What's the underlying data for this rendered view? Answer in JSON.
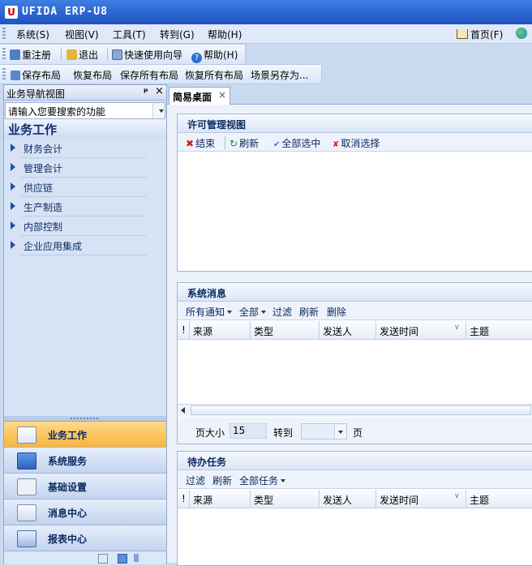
{
  "app": {
    "title": "UFIDA ERP-U8",
    "logo_text": "U"
  },
  "menu": {
    "items": [
      "系统(S)",
      "视图(V)",
      "工具(T)",
      "转到(G)",
      "帮助(H)"
    ],
    "home": "首页(F)"
  },
  "toolbar1": [
    "重注册",
    "退出",
    "快速使用向导",
    "帮助(H)"
  ],
  "toolbar2": [
    "保存布局",
    "恢复布局",
    "保存所有布局",
    "恢复所有布局",
    "场景另存为..."
  ],
  "nav": {
    "header": "业务导航视图",
    "pin": "ᵖ",
    "close": "×",
    "search_placeholder": "请输入您要搜索的功能",
    "section_title": "业务工作",
    "items": [
      "财务会计",
      "管理会计",
      "供应链",
      "生产制造",
      "内部控制",
      "企业应用集成"
    ],
    "buttons": [
      "业务工作",
      "系统服务",
      "基础设置",
      "消息中心",
      "报表中心"
    ]
  },
  "tab": {
    "label": "简易桌面",
    "close": "×"
  },
  "license_panel": {
    "title": "许可管理视图",
    "tools": [
      "结束",
      "刷新",
      "全部选中",
      "取消选择"
    ]
  },
  "messages_panel": {
    "title": "系统消息",
    "tools": [
      "所有通知",
      "全部",
      "过滤",
      "刷新",
      "删除"
    ],
    "columns": [
      "!",
      "来源",
      "类型",
      "发送人",
      "发送时间",
      "主题"
    ],
    "page_size_label": "页大小",
    "page_size_value": "15",
    "goto_label": "转到",
    "page_label": "页"
  },
  "tasks_panel": {
    "title": "待办任务",
    "tools": [
      "过滤",
      "刷新",
      "全部任务"
    ],
    "columns": [
      "!",
      "来源",
      "类型",
      "发送人",
      "发送时间",
      "主题"
    ]
  },
  "colors": {
    "title_bar": "#2a63cf",
    "active_button": "#f7b53e",
    "nav_text": "#0f2f66"
  }
}
